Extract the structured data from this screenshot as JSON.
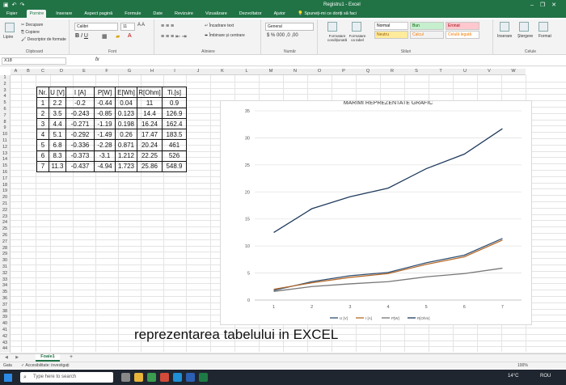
{
  "window": {
    "title": "Registru1 - Excel",
    "qat_icons": [
      "save-icon",
      "undo-icon",
      "redo-icon"
    ],
    "controls": [
      "minimize",
      "restore",
      "close"
    ]
  },
  "ribbon_tabs": [
    "Fișier",
    "Pornire",
    "Inserare",
    "Aspect pagină",
    "Formule",
    "Date",
    "Revizuire",
    "Vizualizare",
    "Dezvoltator",
    "Ajutor"
  ],
  "active_tab": "Pornire",
  "tell_me": "Spuneți-mi ce doriți să faci",
  "clipboard": {
    "paste": "Lipire",
    "cut": "Decupare",
    "copy": "Copiere",
    "format_painter": "Descriptor de formate",
    "label": "Clipboard"
  },
  "font": {
    "name": "Calibri",
    "size": "11",
    "label": "Font"
  },
  "alignment": {
    "wrap": "Încadrare text",
    "merge": "Îmbinare și centrare",
    "label": "Aliniere"
  },
  "number": {
    "format": "General",
    "label": "Număr"
  },
  "styles": {
    "conditional": "Formatare condiționată",
    "as_table": "Formatare ca tabel",
    "cells": [
      {
        "label": "Normal",
        "bg": "#ffffff",
        "fg": "#000000"
      },
      {
        "label": "Bun",
        "bg": "#c6efce",
        "fg": "#006100"
      },
      {
        "label": "Eronat",
        "bg": "#ffc7ce",
        "fg": "#9c0006"
      },
      {
        "label": "Neutru",
        "bg": "#ffeb9c",
        "fg": "#9c5700"
      },
      {
        "label": "Calcul",
        "bg": "#f2f2f2",
        "fg": "#fa7d00"
      },
      {
        "label": "Celulă legată",
        "bg": "#ffffff",
        "fg": "#fa7d00"
      }
    ],
    "label": "Stiluri"
  },
  "cells_group": {
    "insert": "Inserare",
    "delete": "Ștergere",
    "format": "Format",
    "label": "Celule"
  },
  "formula_bar": {
    "name_box": "X18",
    "fx": "fx"
  },
  "columns": [
    "A",
    "B",
    "C",
    "D",
    "E",
    "F",
    "G",
    "H",
    "I",
    "J",
    "K",
    "L",
    "M",
    "N",
    "O",
    "P",
    "Q",
    "R",
    "S",
    "T",
    "U",
    "V",
    "W"
  ],
  "rows": [
    "1",
    "2",
    "3",
    "4",
    "5",
    "6",
    "7",
    "8",
    "9",
    "10",
    "11",
    "12",
    "13",
    "14",
    "15",
    "16",
    "17",
    "18",
    "19",
    "20",
    "21",
    "22",
    "23",
    "24",
    "25",
    "26",
    "27",
    "28",
    "29",
    "30",
    "31",
    "32",
    "33",
    "34",
    "35",
    "36",
    "37",
    "38",
    "39",
    "40",
    "41",
    "42",
    "43",
    "44"
  ],
  "table": {
    "headers": [
      "Nr.",
      "U [V]",
      "I [A]",
      "P[W]",
      "E[Wh]",
      "R[Ohm]",
      "Ti.[s]"
    ],
    "rows": [
      [
        "1",
        "2.2",
        "-0.2",
        "-0.44",
        "0.04",
        "11",
        "0.9"
      ],
      [
        "2",
        "3.5",
        "-0.243",
        "-0.85",
        "0.123",
        "14.4",
        "126.9"
      ],
      [
        "3",
        "4.4",
        "-0.271",
        "-1.19",
        "0.198",
        "16.24",
        "162.4"
      ],
      [
        "4",
        "5.1",
        "-0.292",
        "-1.49",
        "0.26",
        "17.47",
        "183.5"
      ],
      [
        "5",
        "6.8",
        "-0.336",
        "-2.28",
        "0.871",
        "20.24",
        "461"
      ],
      [
        "6",
        "8.3",
        "-0.373",
        "-3.1",
        "1.212",
        "22.25",
        "526"
      ],
      [
        "7",
        "11.3",
        "-0.437",
        "-4.94",
        "1.723",
        "25.86",
        "548.9"
      ]
    ]
  },
  "chart_data": {
    "type": "line",
    "title": "MARIMI   REPREZENTATE   GRAFIC",
    "categories": [
      "1",
      "2",
      "3",
      "4",
      "5",
      "6",
      "7"
    ],
    "ylim": [
      0,
      35
    ],
    "yticks": [
      "0",
      "5",
      "10",
      "15",
      "20",
      "25",
      "30",
      "35"
    ],
    "grid": true,
    "legend_position": "bottom",
    "series": [
      {
        "name": "U [V]",
        "color": "#2f4f73",
        "values": [
          1.8,
          3.4,
          4.5,
          5.1,
          6.9,
          8.3,
          11.4
        ]
      },
      {
        "name": "I [A]",
        "color": "#b56a2a",
        "values": [
          2.0,
          3.2,
          4.2,
          4.9,
          6.6,
          8.0,
          11.1
        ]
      },
      {
        "name": "P[W]",
        "color": "#777777",
        "values": [
          1.6,
          2.5,
          3.0,
          3.4,
          4.3,
          4.9,
          5.9
        ]
      },
      {
        "name": "R[Ohm]",
        "color": "#1f3a5c",
        "values": [
          12.5,
          16.9,
          19.1,
          20.7,
          24.3,
          27.0,
          31.7
        ]
      }
    ]
  },
  "caption": "reprezentarea tabelului in EXCEL",
  "sheet": {
    "tab": "Foaie1",
    "add": "+"
  },
  "status": {
    "ready": "Gata",
    "accessibility": "Accesibilitate: investigați",
    "zoom": "100%"
  },
  "taskbar": {
    "search": "Type here to search",
    "temp": "14°C",
    "lang": "ROU",
    "icons": [
      {
        "name": "task-view-icon",
        "color": "#888888"
      },
      {
        "name": "file-explorer-icon",
        "color": "#e8b43a"
      },
      {
        "name": "chrome-icon",
        "color": "#3b9b4e"
      },
      {
        "name": "chrome-profile-icon",
        "color": "#d24a3a"
      },
      {
        "name": "edge-icon",
        "color": "#1f8fd6"
      },
      {
        "name": "word-icon",
        "color": "#2b5fb3"
      },
      {
        "name": "excel-icon",
        "color": "#1e7a44"
      }
    ]
  }
}
